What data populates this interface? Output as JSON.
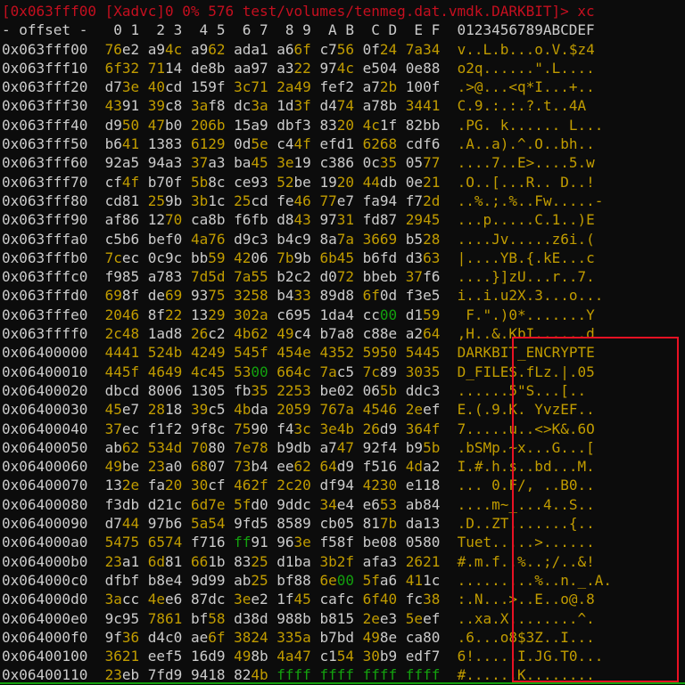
{
  "title_line": "[0x063fff00 [Xadvc]0 0% 576 test/volumes/tenmeg.dat.vmdk.DARKBIT]> xc",
  "header": "- offset -   0 1  2 3  4 5  6 7  8 9  A B  C D  E F  0123456789ABCDEF",
  "rows": [
    {
      "offset": "0x063fff00",
      "words": [
        "76e2",
        "a94c",
        "a962",
        "ada1",
        "a66f",
        "c756",
        "0f24",
        "7a34"
      ],
      "ascii": "v..L.b...o.V.$z4"
    },
    {
      "offset": "0x063fff10",
      "words": [
        "6f32",
        "7114",
        "de8b",
        "aa97",
        "a322",
        "974c",
        "e504",
        "0e88"
      ],
      "ascii": "o2q......\".L...."
    },
    {
      "offset": "0x063fff20",
      "words": [
        "d73e",
        "40cd",
        "159f",
        "3c71",
        "2a49",
        "fef2",
        "a72b",
        "100f"
      ],
      "ascii": ".>@...<q*I...+.."
    },
    {
      "offset": "0x063fff30",
      "words": [
        "4391",
        "39c8",
        "3af8",
        "dc3a",
        "1d3f",
        "d474",
        "a78b",
        "3441"
      ],
      "ascii": "C.9.:.:.?.t..4A"
    },
    {
      "offset": "0x063fff40",
      "words": [
        "d950",
        "47b0",
        "206b",
        "15a9",
        "dbf3",
        "8320",
        "4c1f",
        "82bb"
      ],
      "ascii": ".PG. k...... L..."
    },
    {
      "offset": "0x063fff50",
      "words": [
        "b641",
        "1383",
        "6129",
        "0d5e",
        "c44f",
        "efd1",
        "6268",
        "cdf6"
      ],
      "ascii": ".A..a).^.O..bh.."
    },
    {
      "offset": "0x063fff60",
      "words": [
        "92a5",
        "94a3",
        "37a3",
        "ba45",
        "3e19",
        "c386",
        "0c35",
        "0577"
      ],
      "ascii": "....7..E>....5.w"
    },
    {
      "offset": "0x063fff70",
      "words": [
        "cf4f",
        "b70f",
        "5b8c",
        "ce93",
        "52be",
        "1920",
        "44db",
        "0e21"
      ],
      "ascii": ".O..[...R.. D..!"
    },
    {
      "offset": "0x063fff80",
      "words": [
        "cd81",
        "259b",
        "3b1c",
        "25cd",
        "fe46",
        "77e7",
        "fa94",
        "f72d"
      ],
      "ascii": "..%.;.%..Fw.....-"
    },
    {
      "offset": "0x063fff90",
      "words": [
        "af86",
        "1270",
        "ca8b",
        "f6fb",
        "d843",
        "9731",
        "fd87",
        "2945"
      ],
      "ascii": "...p.....C.1..)E"
    },
    {
      "offset": "0x063fffa0",
      "words": [
        "c5b6",
        "bef0",
        "4a76",
        "d9c3",
        "b4c9",
        "8a7a",
        "3669",
        "b528"
      ],
      "ascii": "....Jv.....z6i.("
    },
    {
      "offset": "0x063fffb0",
      "words": [
        "7cec",
        "0c9c",
        "bb59",
        "4206",
        "7b9b",
        "6b45",
        "b6fd",
        "d363"
      ],
      "ascii": "|....YB.{.kE...c"
    },
    {
      "offset": "0x063fffc0",
      "words": [
        "f985",
        "a783",
        "7d5d",
        "7a55",
        "b2c2",
        "d072",
        "bbeb",
        "37f6"
      ],
      "ascii": "....}]zU...r..7."
    },
    {
      "offset": "0x063fffd0",
      "words": [
        "698f",
        "de69",
        "9375",
        "3258",
        "b433",
        "89d8",
        "6f0d",
        "f3e5"
      ],
      "ascii": "i..i.u2X.3...o..."
    },
    {
      "offset": "0x063fffe0",
      "words": [
        "2046",
        "8f22",
        "1329",
        "302a",
        "c695",
        "1da4",
        "cc00",
        "d159"
      ],
      "ascii": " F.\".)0*.......Y"
    },
    {
      "offset": "0x063ffff0",
      "words": [
        "2c48",
        "1ad8",
        "26c2",
        "4b62",
        "49c4",
        "b7a8",
        "c88e",
        "a264"
      ],
      "ascii": ",H..&.KbI......d"
    },
    {
      "offset": "0x06400000",
      "words": [
        "4441",
        "524b",
        "4249",
        "545f",
        "454e",
        "4352",
        "5950",
        "5445"
      ],
      "ascii": "DARKBIT_ENCRYPTE"
    },
    {
      "offset": "0x06400010",
      "words": [
        "445f",
        "4649",
        "4c45",
        "5300",
        "664c",
        "7ac5",
        "7c89",
        "3035"
      ],
      "ascii": "D_FILES.fLz.|.05"
    },
    {
      "offset": "0x06400020",
      "words": [
        "dbcd",
        "8006",
        "1305",
        "fb35",
        "2253",
        "be02",
        "065b",
        "ddc3"
      ],
      "ascii": "......5\"S...[.."
    },
    {
      "offset": "0x06400030",
      "words": [
        "45e7",
        "2818",
        "39c5",
        "4bda",
        "2059",
        "767a",
        "4546",
        "2eef"
      ],
      "ascii": "E.(.9.K. YvzEF.."
    },
    {
      "offset": "0x06400040",
      "words": [
        "37ec",
        "f1f2",
        "9f8c",
        "7590",
        "f43c",
        "3e4b",
        "26d9",
        "364f"
      ],
      "ascii": "7.....u..<>K&.6O"
    },
    {
      "offset": "0x06400050",
      "words": [
        "ab62",
        "534d",
        "7080",
        "7e78",
        "b9db",
        "a747",
        "92f4",
        "b95b"
      ],
      "ascii": ".bSMp.~x...G...["
    },
    {
      "offset": "0x06400060",
      "words": [
        "49be",
        "23a0",
        "6807",
        "73b4",
        "ee62",
        "64d9",
        "f516",
        "4da2"
      ],
      "ascii": "I.#.h.s..bd...M."
    },
    {
      "offset": "0x06400070",
      "words": [
        "132e",
        "fa20",
        "30cf",
        "462f",
        "2c20",
        "df94",
        "4230",
        "e118"
      ],
      "ascii": "... 0.F/, ..B0.."
    },
    {
      "offset": "0x06400080",
      "words": [
        "f3db",
        "d21c",
        "6d7e",
        "5fd0",
        "9ddc",
        "34e4",
        "e653",
        "ab84"
      ],
      "ascii": "....m~_...4..S.."
    },
    {
      "offset": "0x06400090",
      "words": [
        "d744",
        "97b6",
        "5a54",
        "9fd5",
        "8589",
        "cb05",
        "817b",
        "da13"
      ],
      "ascii": ".D..ZT.......{.."
    },
    {
      "offset": "0x064000a0",
      "words": [
        "5475",
        "6574",
        "f716",
        "ff91",
        "963e",
        "f58f",
        "be08",
        "0580"
      ],
      "ascii": "Tuet.....>......"
    },
    {
      "offset": "0x064000b0",
      "words": [
        "23a1",
        "6d81",
        "661b",
        "8325",
        "d1ba",
        "3b2f",
        "afa3",
        "2621"
      ],
      "ascii": "#.m.f..%..;/..&!"
    },
    {
      "offset": "0x064000c0",
      "words": [
        "dfbf",
        "b8e4",
        "9d99",
        "ab25",
        "bf88",
        "6e00",
        "5fa6",
        "411c"
      ],
      "ascii": ".........%..n._.A."
    },
    {
      "offset": "0x064000d0",
      "words": [
        "3acc",
        "4ee6",
        "87dc",
        "3ee2",
        "1f45",
        "cafc",
        "6f40",
        "fc38"
      ],
      "ascii": ":.N...>..E..o@.8"
    },
    {
      "offset": "0x064000e0",
      "words": [
        "9c95",
        "7861",
        "bf58",
        "d38d",
        "988b",
        "b815",
        "2ee3",
        "5eef"
      ],
      "ascii": "..xa.X........^."
    },
    {
      "offset": "0x064000f0",
      "words": [
        "9f36",
        "d4c0",
        "ae6f",
        "3824",
        "335a",
        "b7bd",
        "498e",
        "ca80"
      ],
      "ascii": ".6...o8$3Z..I..."
    },
    {
      "offset": "0x06400100",
      "words": [
        "3621",
        "eef5",
        "16d9",
        "498b",
        "4a47",
        "c154",
        "30b9",
        "edf7"
      ],
      "ascii": "6!.....I.JG.T0..."
    },
    {
      "offset": "0x06400110",
      "words": [
        "23eb",
        "7fd9",
        "9418",
        "824b",
        "ffff",
        "ffff",
        "ffff",
        "ffff"
      ],
      "ascii": "#......K........"
    }
  ]
}
